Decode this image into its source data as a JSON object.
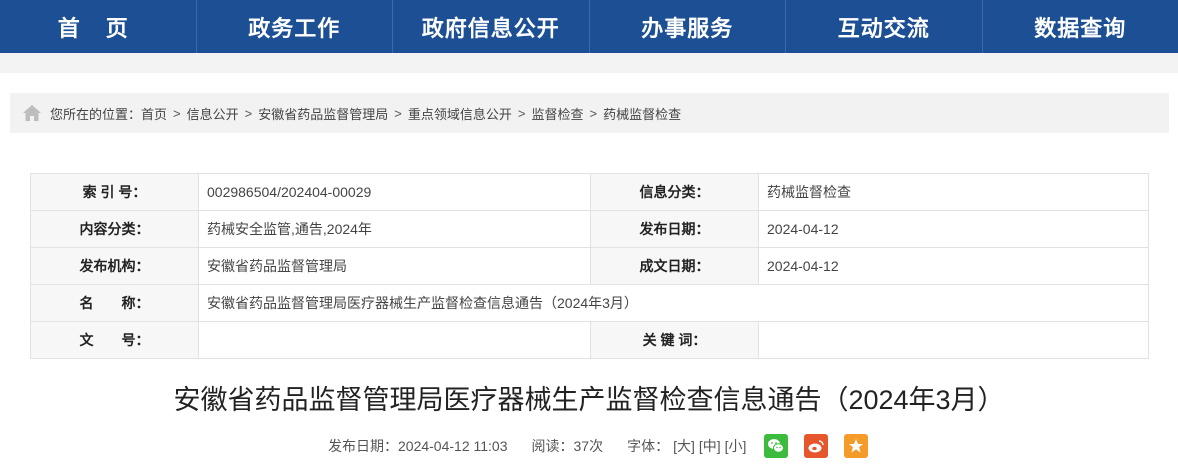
{
  "nav": {
    "items": [
      {
        "label": "首 页"
      },
      {
        "label": "政务工作"
      },
      {
        "label": "政府信息公开"
      },
      {
        "label": "办事服务"
      },
      {
        "label": "互动交流"
      },
      {
        "label": "数据查询"
      }
    ]
  },
  "breadcrumb": {
    "prefix": "您所在的位置：",
    "items": [
      "首页",
      "信息公开",
      "安徽省药品监督管理局",
      "重点领域信息公开",
      "监督检查",
      "药械监督检查"
    ],
    "separator": ">"
  },
  "info_table": {
    "index_label": "索 引 号：",
    "index_value": "002986504/202404-00029",
    "category_label": "信息分类：",
    "category_value": "药械监督检查",
    "content_label": "内容分类：",
    "content_value": "药械安全监管,通告,2024年",
    "pubdate_label": "发布日期：",
    "pubdate_value": "2024-04-12",
    "org_label": "发布机构：",
    "org_value": "安徽省药品监督管理局",
    "docdate_label": "成文日期：",
    "docdate_value": "2024-04-12",
    "name_label": "名　　称：",
    "name_value": "安徽省药品监督管理局医疗器械生产监督检查信息通告（2024年3月）",
    "docno_label": "文　　号：",
    "docno_value": "",
    "keywords_label": "关 键 词：",
    "keywords_value": ""
  },
  "article": {
    "title": "安徽省药品监督管理局医疗器械生产监督检查信息通告（2024年3月）",
    "date_text": "发布日期：2024-04-12 11:03",
    "views_text": "阅读：37次",
    "fontsize_label": "字体：",
    "font_large": "[大]",
    "font_medium": "[中]",
    "font_small": "[小]"
  },
  "share": {
    "wechat_icon": "wechat-icon",
    "weibo_icon": "weibo-icon",
    "favorite_icon": "star-icon",
    "wechat_color": "#3dbb3d",
    "weibo_color": "#e6552b",
    "favorite_color": "#f59b2a"
  },
  "colors": {
    "nav_bg": "#1d4f94",
    "breadcrumb_bg": "#f2f2f2",
    "label_bg": "#f7f7f7"
  }
}
